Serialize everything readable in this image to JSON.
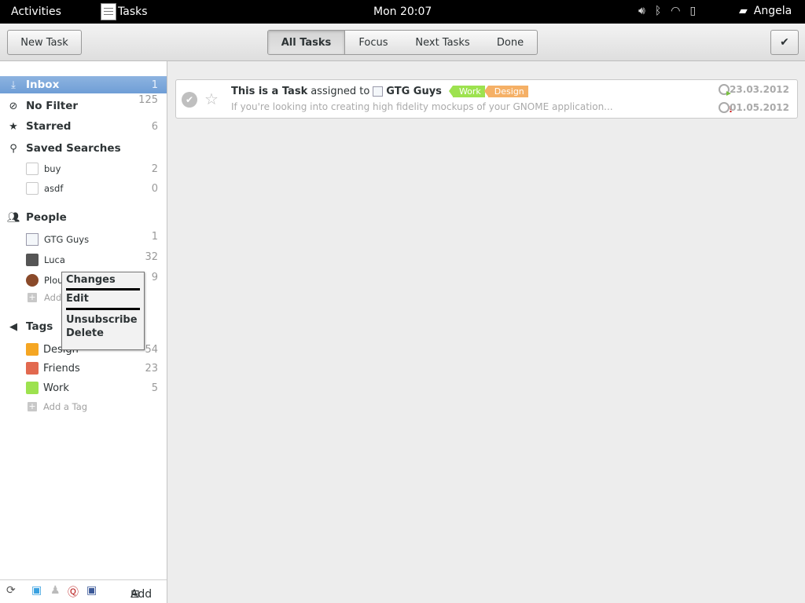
{
  "topbar": {
    "activities": "Activities",
    "app_name": "Tasks",
    "clock": "Mon 20:07",
    "user": "Angela",
    "tray_icons": [
      "volume-icon",
      "bluetooth-icon",
      "wifi-icon",
      "battery-icon",
      "chat-icon"
    ]
  },
  "toolbar": {
    "new_task": "New Task",
    "views": [
      "All Tasks",
      "Focus",
      "Next Tasks",
      "Done"
    ],
    "active_view": "All Tasks",
    "check_icon": "✔"
  },
  "sidebar": {
    "inbox": {
      "label": "Inbox",
      "count": "1"
    },
    "no_filter": {
      "label": "No Filter",
      "count": "125"
    },
    "starred": {
      "label": "Starred",
      "count": "6"
    },
    "saved_searches": {
      "label": "Saved Searches",
      "items": [
        {
          "label": "buy",
          "count": "2"
        },
        {
          "label": "asdf",
          "count": "0"
        }
      ]
    },
    "people": {
      "label": "People",
      "items": [
        {
          "label": "GTG Guys",
          "count": "1"
        },
        {
          "label": "Luca",
          "count": "32"
        },
        {
          "label": "Plou",
          "count": "9"
        }
      ],
      "add_label": "Add"
    },
    "tags": {
      "label": "Tags",
      "items": [
        {
          "label": "Design",
          "count": "54",
          "color": "#f5a623"
        },
        {
          "label": "Friends",
          "count": "23",
          "color": "#e2694f"
        },
        {
          "label": "Work",
          "count": "5",
          "color": "#9de24f"
        }
      ],
      "add_label": "Add a Tag"
    },
    "bottom": {
      "add_label": "Add"
    }
  },
  "context_menu": {
    "items": [
      "Changes",
      "Edit",
      "Unsubscribe",
      "Delete"
    ]
  },
  "task": {
    "title_bold": "This is a Task",
    "title_mid": "assigned to",
    "assignee": "GTG Guys",
    "tags": [
      {
        "label": "Work",
        "color": "#9de24f"
      },
      {
        "label": "Design",
        "color": "#f5b066"
      }
    ],
    "description": "If you're looking into creating high fidelity mockups of your GNOME application...",
    "start_date": "23.03.2012",
    "due_date": "01.05.2012"
  }
}
